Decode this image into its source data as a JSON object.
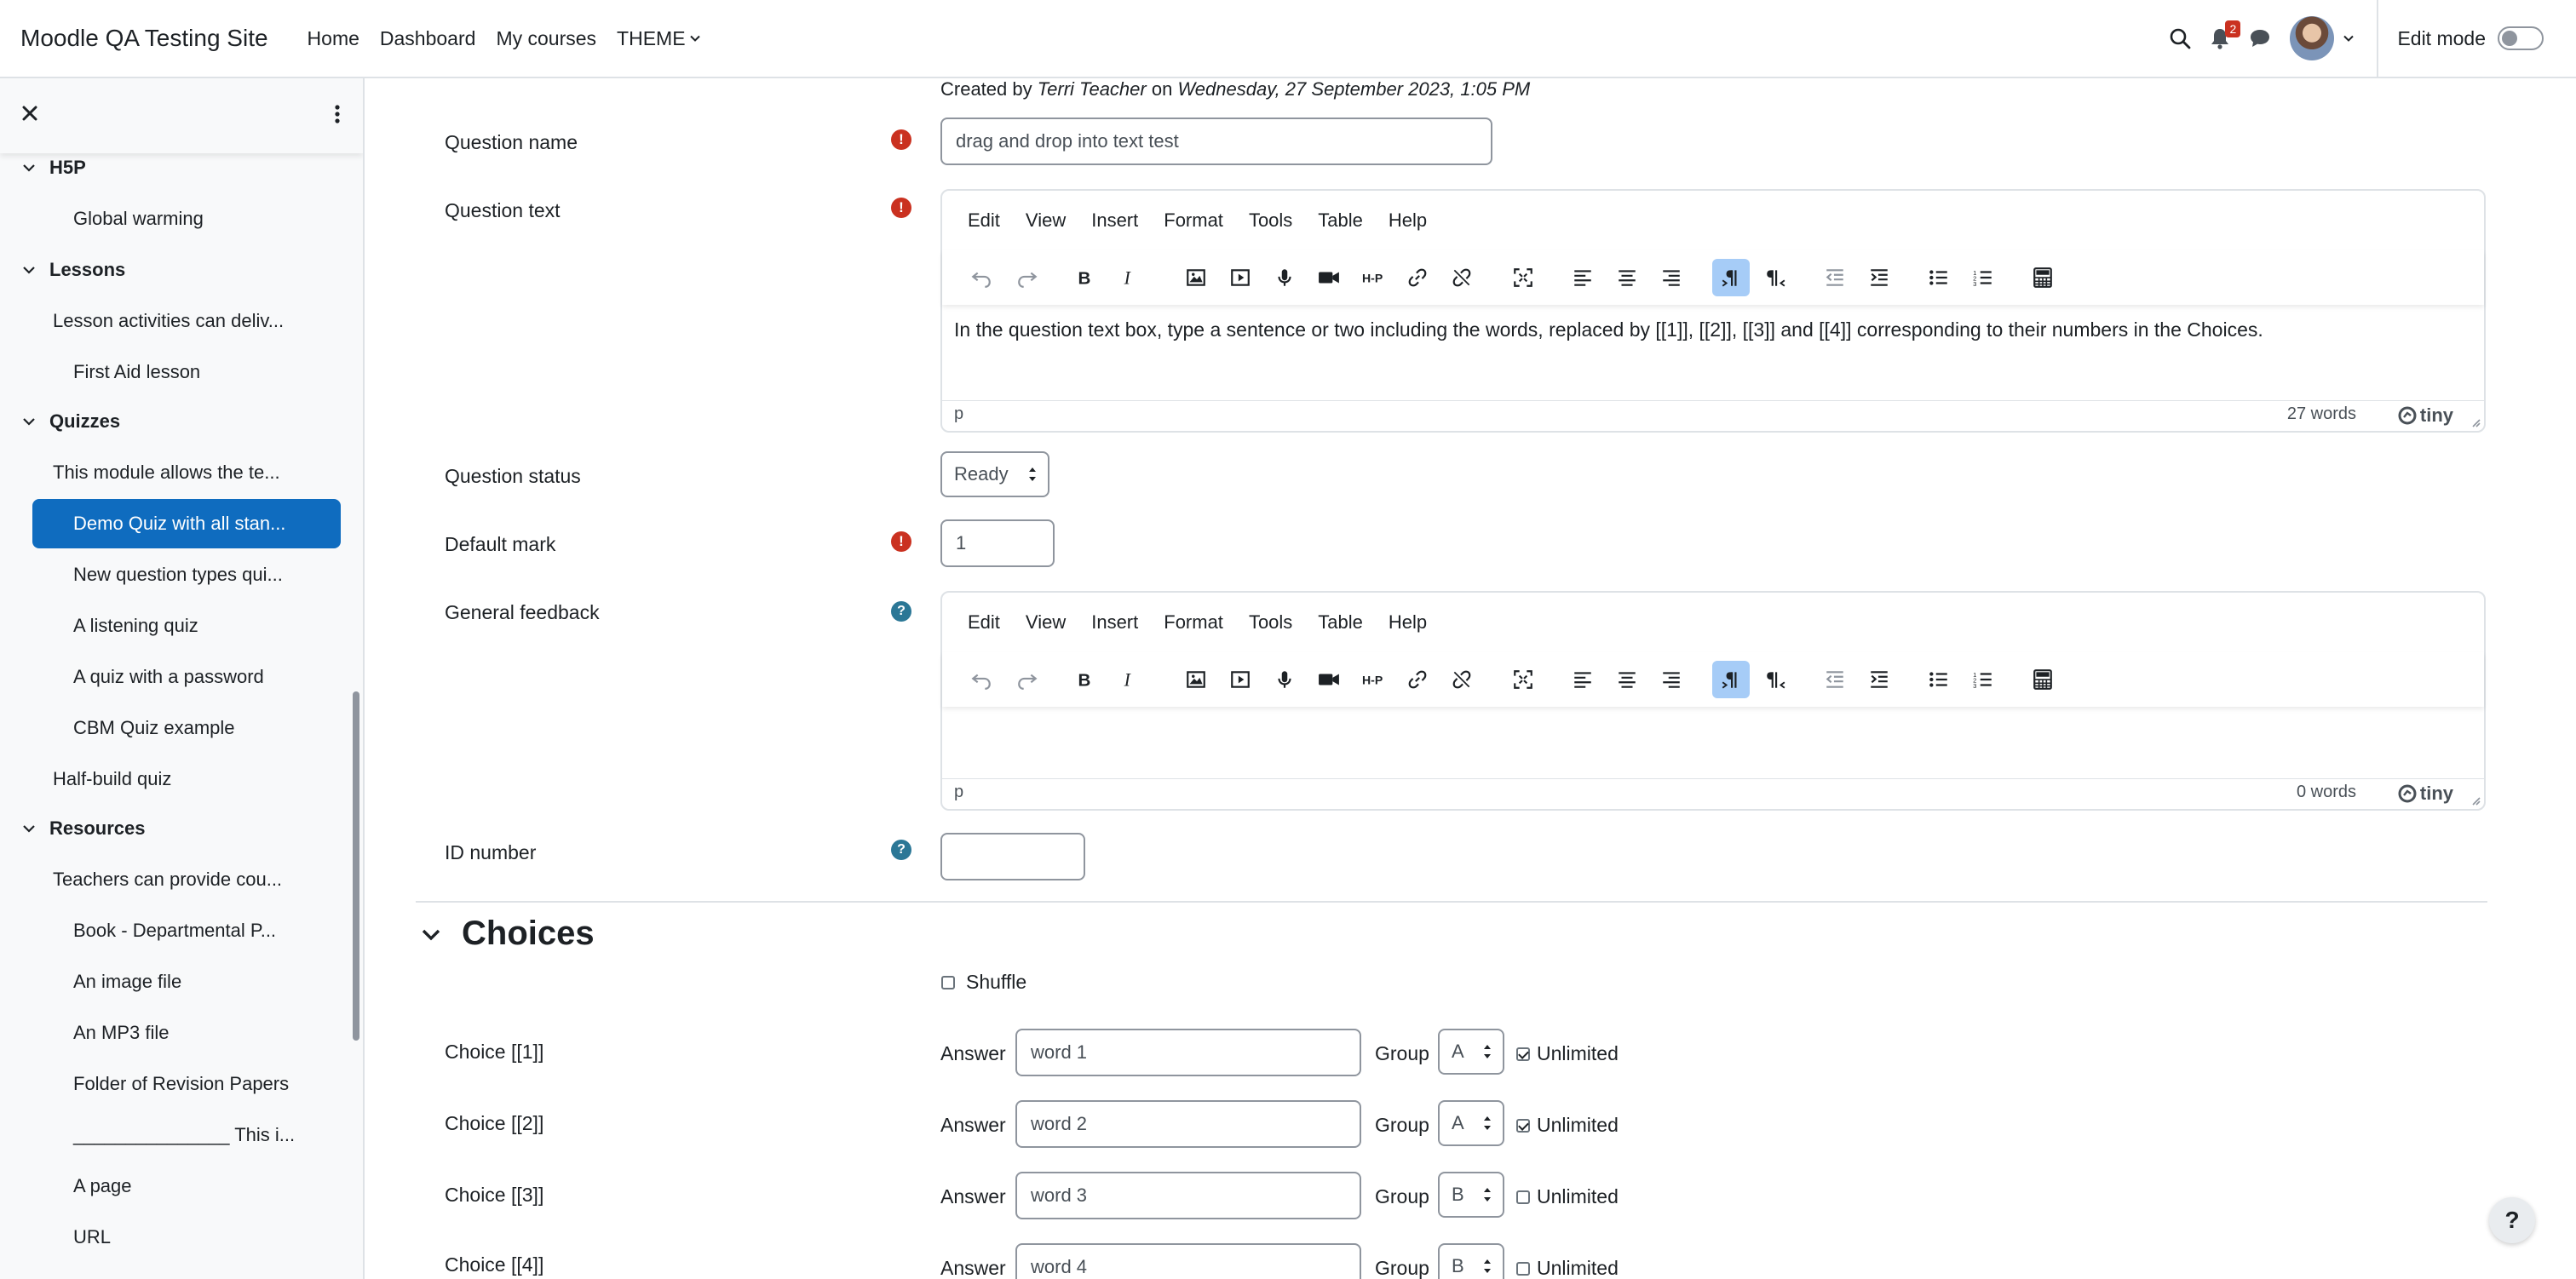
{
  "navbar": {
    "brand": "Moodle QA Testing Site",
    "links": [
      "Home",
      "Dashboard",
      "My courses",
      "THEME"
    ],
    "notification_count": "2",
    "edit_mode_label": "Edit mode"
  },
  "drawer": {
    "items": [
      {
        "label": "H5P",
        "type": "section"
      },
      {
        "label": "Global warming",
        "type": "activity"
      },
      {
        "label": "Lessons",
        "type": "section"
      },
      {
        "label": "Lesson activities can deliv...",
        "type": "summary"
      },
      {
        "label": "First Aid lesson",
        "type": "activity"
      },
      {
        "label": "Quizzes",
        "type": "section"
      },
      {
        "label": "This module allows the te...",
        "type": "summary"
      },
      {
        "label": "Demo Quiz with all stan...",
        "type": "activity",
        "active": true
      },
      {
        "label": "New question types qui...",
        "type": "activity"
      },
      {
        "label": "A listening quiz",
        "type": "activity"
      },
      {
        "label": "A quiz with a password",
        "type": "activity"
      },
      {
        "label": "CBM Quiz example",
        "type": "activity"
      },
      {
        "label": "Half-build quiz",
        "type": "summary"
      },
      {
        "label": "Resources",
        "type": "section"
      },
      {
        "label": "Teachers can provide cou...",
        "type": "summary"
      },
      {
        "label": "Book - Departmental P...",
        "type": "activity"
      },
      {
        "label": "An image file",
        "type": "activity"
      },
      {
        "label": "An MP3 file",
        "type": "activity"
      },
      {
        "label": "Folder of Revision Papers",
        "type": "activity"
      },
      {
        "label": "_______________ This i...",
        "type": "activity"
      },
      {
        "label": "A page",
        "type": "activity"
      },
      {
        "label": "URL",
        "type": "activity"
      }
    ]
  },
  "form": {
    "created_prefix": "Created by ",
    "created_author": "Terri Teacher",
    "created_on": " on ",
    "created_date": "Wednesday, 27 September 2023, 1:05 PM",
    "question_name_label": "Question name",
    "question_name_value": "drag and drop into text test",
    "question_text_label": "Question text",
    "question_text_body": "In the question text box, type a sentence or two including the words, replaced by [[1]], [[2]], [[3]] and [[4]] corresponding to their numbers in the Choices.",
    "question_text_words": "27 words",
    "question_status_label": "Question status",
    "question_status_value": "Ready",
    "default_mark_label": "Default mark",
    "default_mark_value": "1",
    "general_feedback_label": "General feedback",
    "general_feedback_words": "0 words",
    "id_number_label": "ID number",
    "id_number_value": "",
    "editor_menu": [
      "Edit",
      "View",
      "Insert",
      "Format",
      "Tools",
      "Table",
      "Help"
    ],
    "editor_path": "p",
    "tiny_brand": "tiny"
  },
  "choices": {
    "heading": "Choices",
    "shuffle_label": "Shuffle",
    "shuffle_checked": false,
    "answer_label": "Answer",
    "group_label": "Group",
    "unlimited_label": "Unlimited",
    "rows": [
      {
        "label": "Choice [[1]]",
        "answer": "word 1",
        "group": "A",
        "unlimited": true
      },
      {
        "label": "Choice [[2]]",
        "answer": "word 2",
        "group": "A",
        "unlimited": true
      },
      {
        "label": "Choice [[3]]",
        "answer": "word 3",
        "group": "B",
        "unlimited": false
      },
      {
        "label": "Choice [[4]]",
        "answer": "word 4",
        "group": "B",
        "unlimited": false
      }
    ]
  },
  "help_fab": "?",
  "colors": {
    "brand": "#0f6cbf",
    "required": "#ca3120",
    "help": "#2b7796",
    "active_tool": "#a6ccf7"
  }
}
